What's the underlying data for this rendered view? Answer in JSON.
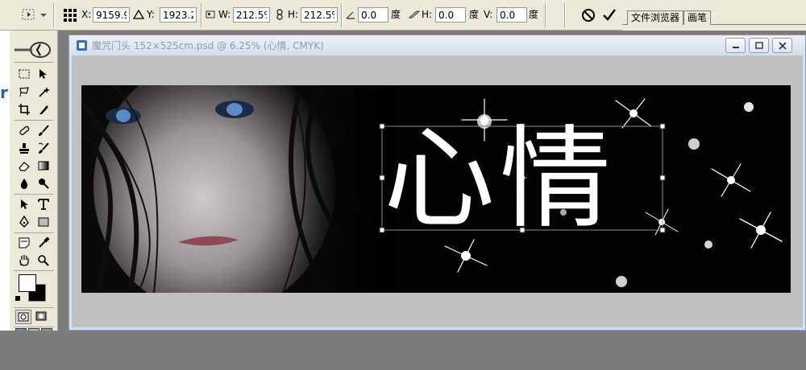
{
  "options_bar": {
    "x_label": "X:",
    "x_value": "9159.9",
    "y_label": "Y:",
    "y_value": "1923.2",
    "w_label": "W:",
    "w_value": "212.5%",
    "h_label": "H:",
    "h_value": "212.5%",
    "angle_value": "0.0",
    "angle_unit": "度",
    "skew_h_label": "H:",
    "skew_h_value": "0.0",
    "skew_h_unit": "度",
    "skew_v_label": "V:",
    "skew_v_value": "0.0",
    "skew_v_unit": "度"
  },
  "palette_well": {
    "tab_file_browser": "文件浏览器",
    "tab_brushes": "画笔"
  },
  "left_strip": {
    "partial_letter": "r"
  },
  "document": {
    "title": "魔咒门头  152×525cm.psd @ 6.25% (心情, CMYK)",
    "canvas_text": "心情"
  },
  "colors": {
    "foreground": "#ffffff",
    "background": "#000000",
    "accent": "#2d5fa5"
  }
}
